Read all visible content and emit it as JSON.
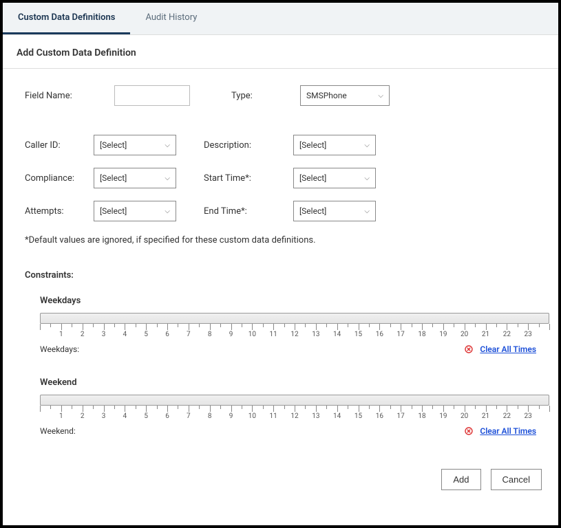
{
  "tabs": {
    "custom": "Custom Data Definitions",
    "audit": "Audit History"
  },
  "page_title": "Add Custom Data Definition",
  "form": {
    "field_name_label": "Field Name:",
    "field_name_value": "",
    "type_label": "Type:",
    "type_value": "SMSPhone",
    "caller_id_label": "Caller ID:",
    "caller_id_value": "[Select]",
    "description_label": "Description:",
    "description_value": "[Select]",
    "compliance_label": "Compliance:",
    "compliance_value": "[Select]",
    "start_time_label": "Start Time*:",
    "start_time_value": "[Select]",
    "attempts_label": "Attempts:",
    "attempts_value": "[Select]",
    "end_time_label": "End Time*:",
    "end_time_value": "[Select]"
  },
  "note": "*Default values are ignored, if specified for these custom data definitions.",
  "constraints": {
    "title": "Constraints:",
    "weekdays_heading": "Weekdays",
    "weekdays_label": "Weekdays:",
    "weekend_heading": "Weekend",
    "weekend_label": "Weekend:",
    "clear_link": "Clear All Times",
    "hours": [
      "1",
      "2",
      "3",
      "4",
      "5",
      "6",
      "7",
      "8",
      "9",
      "10",
      "11",
      "12",
      "13",
      "14",
      "15",
      "16",
      "17",
      "18",
      "19",
      "20",
      "21",
      "22",
      "23"
    ]
  },
  "buttons": {
    "add": "Add",
    "cancel": "Cancel"
  }
}
